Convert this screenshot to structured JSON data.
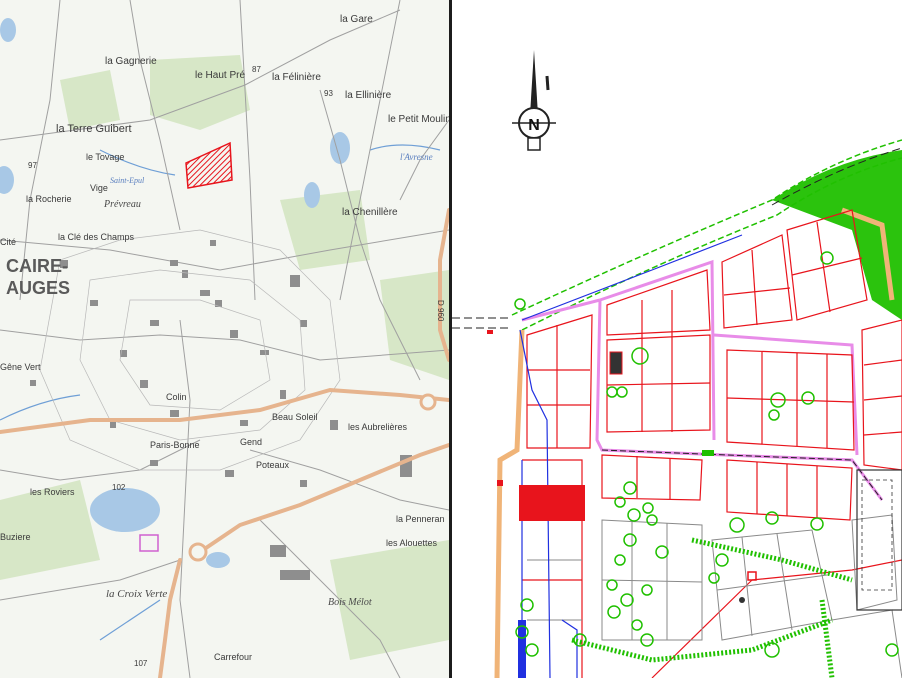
{
  "colors": {
    "map_bg": "#f4f6f1",
    "road_major": "#e6b48e",
    "road_minor": "#9a9a9a",
    "water": "#a8c8e6",
    "forest": "#d4e6c2",
    "site": "#e8141c",
    "plan_red": "#e8141c",
    "plan_green": "#20c000",
    "plan_blue": "#2030e0",
    "plan_orange": "#f0b478"
  },
  "left_map": {
    "place_labels": [
      "la Gare",
      "la Gagnerie",
      "le Haut Pré",
      "la Félinière",
      "la Ellinière",
      "le Petit Moulin",
      "la Terre Guibert",
      "le Tovage",
      "Vige",
      "la Rocherie",
      "Prévreau",
      "la Chenillère",
      "la Clé des Champs",
      "Colin",
      "Beau Soleil",
      "les Aubrelières",
      "Gend",
      "Poteaux",
      "Paris-Bonne",
      "les Roviers",
      "la Penneran",
      "les Alouettes",
      "Buziere",
      "la Croix Verte",
      "Bois Mélot",
      "Carrefour",
      "Gêne Vert",
      "Saint-Epul",
      "l'Avresne",
      "Cité"
    ],
    "town_name_lines": [
      "CAIRE-",
      "AUGES"
    ],
    "road_refs": [
      "97",
      "93",
      "102",
      "107",
      "87",
      "D 960"
    ]
  },
  "plan": {
    "north_label": "N",
    "icons": [
      "north-arrow-icon"
    ]
  }
}
